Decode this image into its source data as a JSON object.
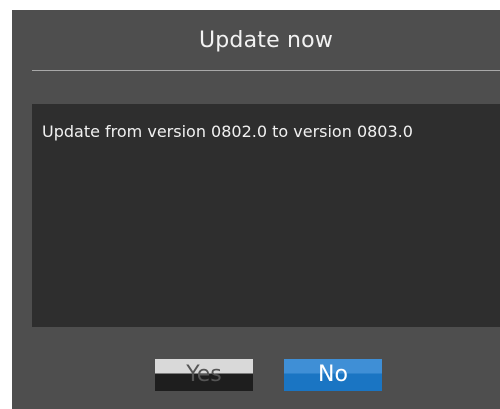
{
  "dialog": {
    "title": "Update now",
    "message": "Update from version 0802.0 to version 0803.0",
    "buttons": {
      "yes_label": "Yes",
      "no_label": "No"
    }
  },
  "colors": {
    "dialog_background": "#4e4e4e",
    "message_panel_background": "#2e2e2e",
    "focused_button": "#1a75c3"
  },
  "state": {
    "focused_button": "No"
  }
}
